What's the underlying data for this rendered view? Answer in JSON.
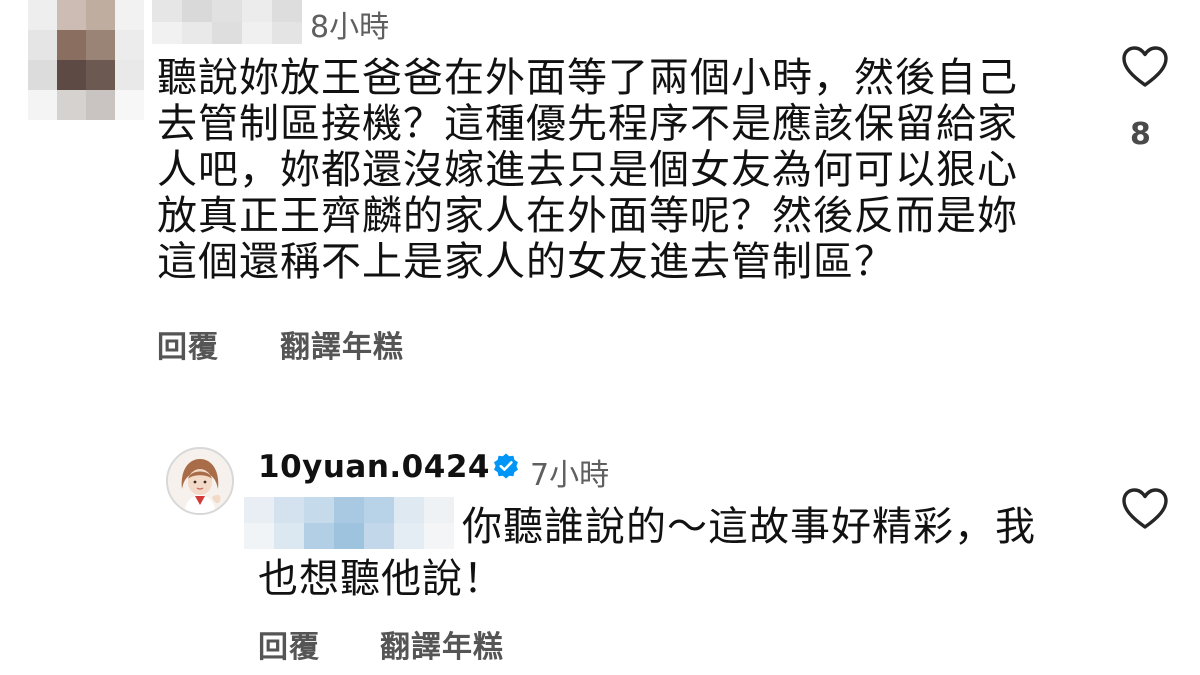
{
  "comment": {
    "time": "8小時",
    "text_lines": [
      "聽說妳放王爸爸在外面等了兩個小時，然後自己",
      "去管制區接機？這種優先程序不是應該保留給家",
      "人吧，妳都還沒嫁進去只是個女友為何可以狠心",
      "放真正王齊麟的家人在外面等呢？然後反而是妳",
      "這個還稱不上是家人的女友進去管制區？"
    ],
    "reply_label": "回覆",
    "translate_label": "翻譯年糕",
    "like_count": "8",
    "like_icon": "heart-outline-icon"
  },
  "reply": {
    "username": "10yuan.0424",
    "verified_icon": "verified-badge-icon",
    "time": "7小時",
    "text_line1": "你聽誰說的～這故事好精彩，我",
    "text_line2": "也想聽他說！",
    "reply_label": "回覆",
    "translate_label": "翻譯年糕",
    "like_icon": "heart-outline-icon"
  },
  "colors": {
    "text": "#111111",
    "muted": "#5f5f5f",
    "verified": "#0095f6",
    "mosaic_avatar": [
      "#b9a69c",
      "#7d6558",
      "#5e4a44",
      "#d9d2cf",
      "#e6e6e6"
    ],
    "mosaic_mention": [
      "#c9dcec",
      "#9ec3df",
      "#e6eef5"
    ]
  }
}
